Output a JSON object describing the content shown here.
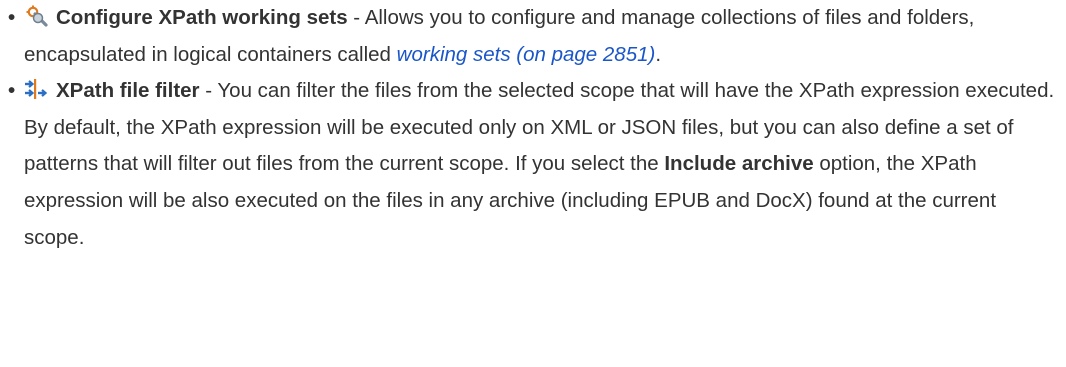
{
  "items": [
    {
      "bullet": "•",
      "icon": "working-sets-icon",
      "term": "Configure XPath working sets",
      "text_before_link": " - Allows you to configure and manage collections of files and folders, encapsulated in logical containers called ",
      "link_text": "working sets (on page 2851)",
      "text_after_link": "."
    },
    {
      "bullet": "•",
      "icon": "file-filter-icon",
      "term": "XPath file filter",
      "text_before_option": " - You can filter the files from the selected scope that will have the XPath expression executed. By default, the XPath expression will be executed only on XML or JSON files, but you can also define a set of patterns that will filter out files from the current scope. If you select the ",
      "option_label": "Include archive",
      "text_after_option": " option, the XPath expression will be also executed on the files in any archive (including EPUB and DocX) found at the current scope."
    }
  ],
  "colors": {
    "text": "#333333",
    "link": "#1a56c9",
    "icon_orange": "#e07a1f",
    "icon_blue": "#2a6fc2"
  }
}
